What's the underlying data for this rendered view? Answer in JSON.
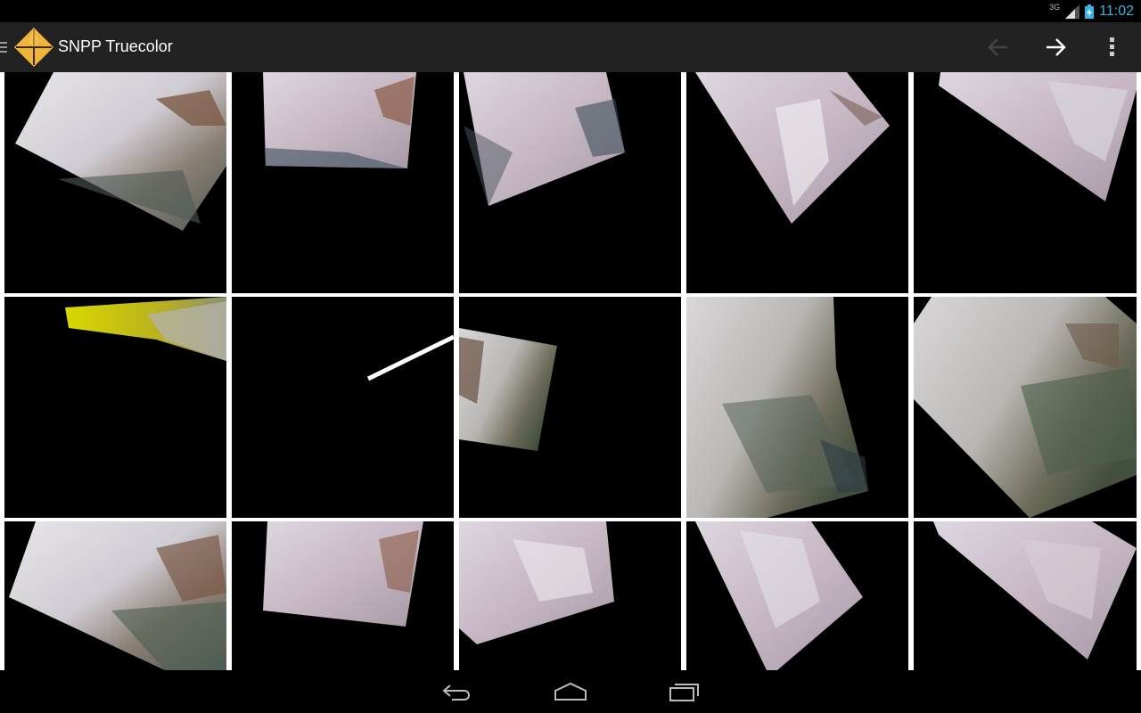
{
  "status_bar": {
    "network": "3G",
    "time": "11:02",
    "clock_color": "#33b5e5"
  },
  "action_bar": {
    "title": "SNPP Truecolor",
    "logo_icon": "compass-star-icon",
    "logo_color": "#f0b43c",
    "actions": [
      {
        "name": "previous",
        "icon": "arrow-left-icon",
        "enabled": false
      },
      {
        "name": "next",
        "icon": "arrow-right-icon",
        "enabled": true
      },
      {
        "name": "more",
        "icon": "overflow-menu-icon",
        "enabled": true
      }
    ]
  },
  "thumbnails": [
    {
      "id": "r1c1",
      "content": "satellite-swath"
    },
    {
      "id": "r1c2",
      "content": "satellite-swath"
    },
    {
      "id": "r1c3",
      "content": "satellite-swath"
    },
    {
      "id": "r1c4",
      "content": "satellite-swath"
    },
    {
      "id": "r1c5",
      "content": "satellite-swath"
    },
    {
      "id": "r2c1",
      "content": "satellite-swath-yellow"
    },
    {
      "id": "r2c2",
      "content": "white-streak"
    },
    {
      "id": "r2c3",
      "content": "satellite-swath"
    },
    {
      "id": "r2c4",
      "content": "satellite-swath"
    },
    {
      "id": "r2c5",
      "content": "satellite-swath"
    },
    {
      "id": "r3c1",
      "content": "satellite-swath"
    },
    {
      "id": "r3c2",
      "content": "satellite-swath"
    },
    {
      "id": "r3c3",
      "content": "satellite-swath"
    },
    {
      "id": "r3c4",
      "content": "satellite-swath"
    },
    {
      "id": "r3c5",
      "content": "satellite-swath"
    }
  ],
  "nav_bar": {
    "buttons": [
      {
        "name": "back",
        "icon": "nav-back-icon"
      },
      {
        "name": "home",
        "icon": "nav-home-icon"
      },
      {
        "name": "recents",
        "icon": "nav-recents-icon"
      }
    ]
  }
}
